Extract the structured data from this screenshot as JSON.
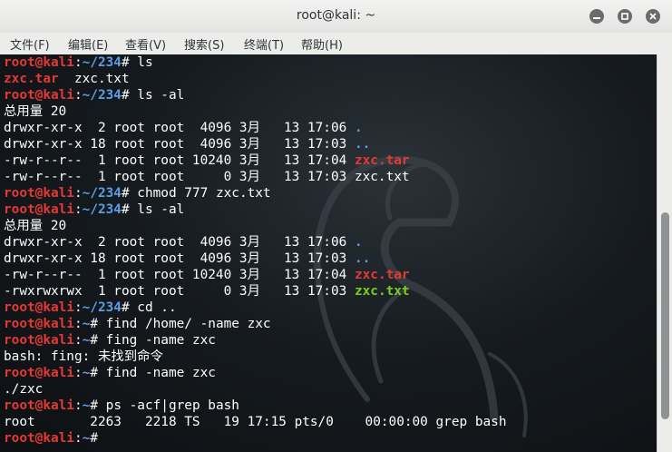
{
  "window": {
    "title": "root@kali: ~"
  },
  "menu": [
    "文件(F)",
    "编辑(E)",
    "查看(V)",
    "搜索(S)",
    "终端(T)",
    "帮助(H)"
  ],
  "colors": {
    "prompt_user": "#e53935",
    "prompt_path": "#5c9ee6",
    "directory": "#5c9ee6",
    "archive": "#e53935",
    "executable": "#7ccf19",
    "text": "#ffffff"
  },
  "icons": [
    "minimize-icon",
    "maximize-icon",
    "close-icon"
  ],
  "terminal": {
    "lines": [
      [
        [
          "root@kali",
          "red"
        ],
        [
          ":",
          "white"
        ],
        [
          "~/234",
          "blue"
        ],
        [
          "# ls",
          "white"
        ]
      ],
      [
        [
          "zxc.tar",
          "red"
        ],
        [
          "  zxc.txt",
          "white"
        ]
      ],
      [
        [
          "root@kali",
          "red"
        ],
        [
          ":",
          "white"
        ],
        [
          "~/234",
          "blue"
        ],
        [
          "# ls -al",
          "white"
        ]
      ],
      [
        [
          "总用量 20",
          "white"
        ]
      ],
      [
        [
          "drwxr-xr-x  2 root root  4096 3月   13 17:06 ",
          "white"
        ],
        [
          ".",
          "blue"
        ]
      ],
      [
        [
          "drwxr-xr-x 18 root root  4096 3月   13 17:03 ",
          "white"
        ],
        [
          "..",
          "blue"
        ]
      ],
      [
        [
          "-rw-r--r--  1 root root 10240 3月   13 17:04 ",
          "white"
        ],
        [
          "zxc.tar",
          "red"
        ]
      ],
      [
        [
          "-rw-r--r--  1 root root     0 3月   13 17:03 zxc.txt",
          "white"
        ]
      ],
      [
        [
          "root@kali",
          "red"
        ],
        [
          ":",
          "white"
        ],
        [
          "~/234",
          "blue"
        ],
        [
          "# chmod 777 zxc.txt",
          "white"
        ]
      ],
      [
        [
          "root@kali",
          "red"
        ],
        [
          ":",
          "white"
        ],
        [
          "~/234",
          "blue"
        ],
        [
          "# ls -al",
          "white"
        ]
      ],
      [
        [
          "总用量 20",
          "white"
        ]
      ],
      [
        [
          "drwxr-xr-x  2 root root  4096 3月   13 17:06 ",
          "white"
        ],
        [
          ".",
          "blue"
        ]
      ],
      [
        [
          "drwxr-xr-x 18 root root  4096 3月   13 17:03 ",
          "white"
        ],
        [
          "..",
          "blue"
        ]
      ],
      [
        [
          "-rw-r--r--  1 root root 10240 3月   13 17:04 ",
          "white"
        ],
        [
          "zxc.tar",
          "red"
        ]
      ],
      [
        [
          "-rwxrwxrwx  1 root root     0 3月   13 17:03 ",
          "white"
        ],
        [
          "zxc.txt",
          "green"
        ]
      ],
      [
        [
          "root@kali",
          "red"
        ],
        [
          ":",
          "white"
        ],
        [
          "~/234",
          "blue"
        ],
        [
          "# cd ..",
          "white"
        ]
      ],
      [
        [
          "root@kali",
          "red"
        ],
        [
          ":",
          "white"
        ],
        [
          "~",
          "blue"
        ],
        [
          "# find /home/ -name zxc",
          "white"
        ]
      ],
      [
        [
          "root@kali",
          "red"
        ],
        [
          ":",
          "white"
        ],
        [
          "~",
          "blue"
        ],
        [
          "# fing -name zxc",
          "white"
        ]
      ],
      [
        [
          "bash: fing: 未找到命令",
          "white"
        ]
      ],
      [
        [
          "root@kali",
          "red"
        ],
        [
          ":",
          "white"
        ],
        [
          "~",
          "blue"
        ],
        [
          "# find -name zxc",
          "white"
        ]
      ],
      [
        [
          "./zxc",
          "white"
        ]
      ],
      [
        [
          "root@kali",
          "red"
        ],
        [
          ":",
          "white"
        ],
        [
          "~",
          "blue"
        ],
        [
          "# ps -acf|grep bash",
          "white"
        ]
      ],
      [
        [
          "root       2263   2218 TS   19 17:15 pts/0    00:00:00 grep bash",
          "white"
        ]
      ],
      [
        [
          "root@kali",
          "red"
        ],
        [
          ":",
          "white"
        ],
        [
          "~",
          "blue"
        ],
        [
          "# ",
          "white"
        ]
      ]
    ]
  },
  "scrollbar": {
    "position": 0.84,
    "visible_fraction": 0.53
  }
}
